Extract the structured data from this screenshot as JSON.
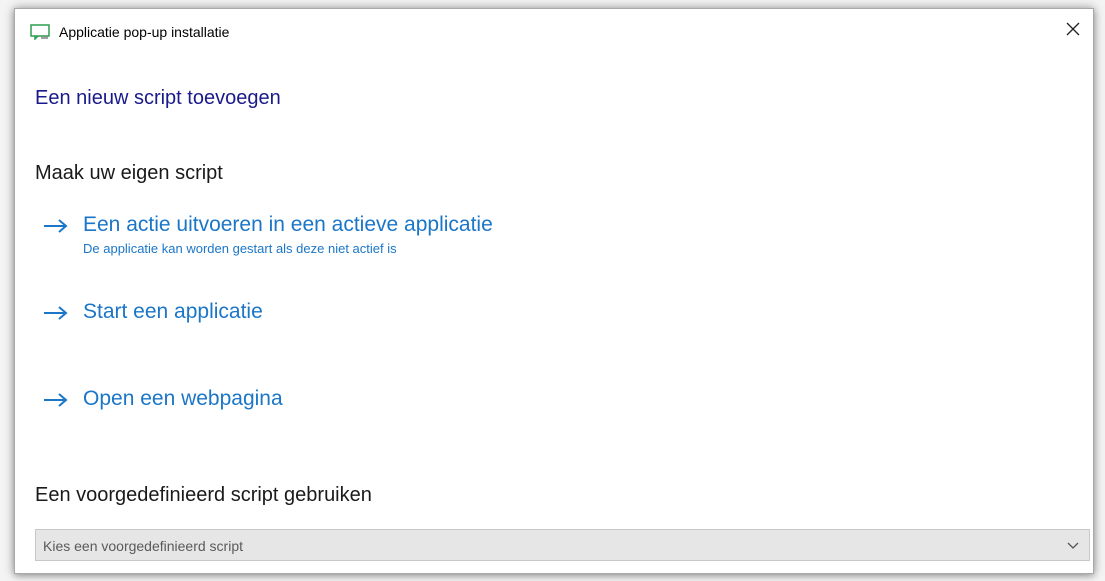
{
  "window": {
    "title": "Applicatie pop-up installatie",
    "icon": "window-popup-icon",
    "close_icon": "close-icon"
  },
  "page": {
    "title": "Een nieuw script toevoegen"
  },
  "own_script": {
    "heading": "Maak uw eigen script",
    "actions": [
      {
        "label": "Een actie uitvoeren in een actieve applicatie",
        "sublabel": "De applicatie kan worden gestart als deze niet actief is",
        "icon": "arrow-right-icon"
      },
      {
        "label": "Start een applicatie",
        "icon": "arrow-right-icon"
      },
      {
        "label": "Open een webpagina",
        "icon": "arrow-right-icon"
      }
    ]
  },
  "predefined_script": {
    "heading": "Een voorgedefinieerd script gebruiken",
    "select_value": "Kies een voorgedefinieerd script",
    "chevron_icon": "chevron-down-icon"
  },
  "colors": {
    "link": "#1b76c7",
    "title": "#1a1a8c",
    "icon_green": "#2e9e4f"
  }
}
